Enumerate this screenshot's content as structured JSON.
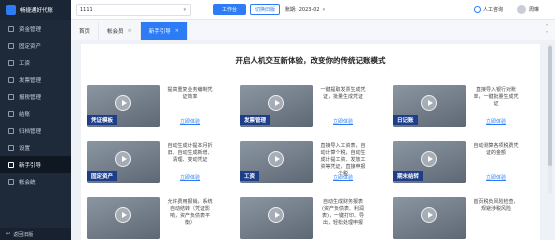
{
  "app": {
    "name": "畅捷通好代账"
  },
  "sidebar": {
    "items": [
      {
        "label": "资金管理",
        "icon": "wallet-icon"
      },
      {
        "label": "固定资产",
        "icon": "asset-icon"
      },
      {
        "label": "工资",
        "icon": "salary-icon"
      },
      {
        "label": "发票管理",
        "icon": "invoice-icon"
      },
      {
        "label": "报税管理",
        "icon": "tax-icon"
      },
      {
        "label": "结账",
        "icon": "close-book-icon"
      },
      {
        "label": "归档管理",
        "icon": "archive-icon"
      },
      {
        "label": "设置",
        "icon": "settings-icon"
      },
      {
        "label": "新手引导",
        "icon": "guide-icon"
      },
      {
        "label": "帐会统",
        "icon": "stats-icon"
      }
    ],
    "active_index": 8,
    "footer": "返回旧版"
  },
  "topbar": {
    "company_value": "1111",
    "workbench_button": "工作台",
    "switch_button": "切换旧版",
    "period_label": "账期:",
    "period_value": "2023-02",
    "support_label": "人工咨询",
    "user_name": "周琳"
  },
  "tabs": [
    {
      "label": "首页",
      "closable": false
    },
    {
      "label": "帐会员",
      "closable": true
    },
    {
      "label": "新手引导",
      "closable": true
    }
  ],
  "active_tab": 2,
  "main": {
    "headline": "开启人机交互新体验，改变你的传统记账模式",
    "cards": [
      {
        "title": "凭证模板",
        "desc": "提高重复业务编制凭证效率",
        "link": "立即体验"
      },
      {
        "title": "发票管理",
        "desc": "一键提取发票生成凭证，批量生成凭证",
        "link": "立即体验"
      },
      {
        "title": "日记账",
        "desc": "直接导入银行对账单，一键批量生成凭证",
        "link": "立即体验"
      },
      {
        "title": "固定资产",
        "desc": "自动生成计提本月折旧、自动生成新增、清理、变动凭证",
        "link": "立即体验"
      },
      {
        "title": "工资",
        "desc": "直接导入工资表，自动计算个税，自动生成计提工资、发放工资等凭证，直接申报个税",
        "link": "立即体验"
      },
      {
        "title": "期末结转",
        "desc": "自动测算各项税费凭证的金额",
        "link": "立即体验"
      },
      {
        "title": "",
        "desc": "允许费用报销，系统自动结转（凭证影响，资产负债表平衡）",
        "link": ""
      },
      {
        "title": "",
        "desc": "自动生成财务报表(资产负债表、利润表)，一键打印、导出，轻松处理申报",
        "link": ""
      },
      {
        "title": "",
        "desc": "首页税负风险检查，规避涉税风险",
        "link": ""
      }
    ]
  }
}
